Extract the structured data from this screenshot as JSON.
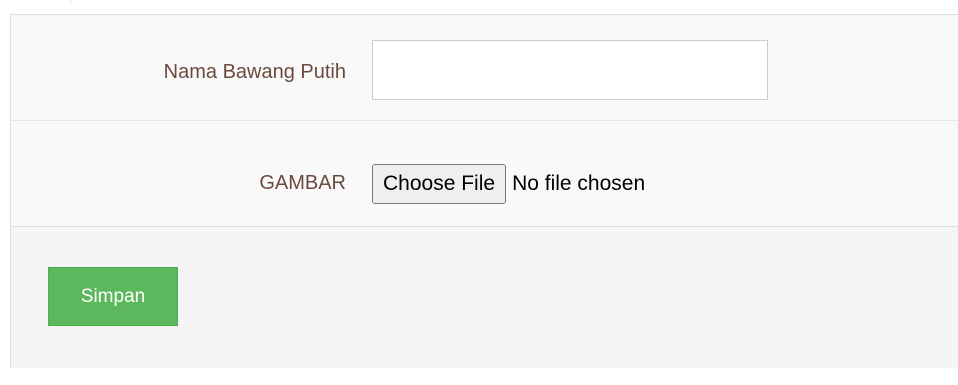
{
  "form": {
    "name_field": {
      "label": "Nama Bawang Putih",
      "value": "",
      "placeholder": ""
    },
    "image_field": {
      "label": "GAMBAR",
      "button_label": "Choose File",
      "status_text": "No file chosen"
    },
    "submit_label": "Simpan"
  },
  "colors": {
    "label_text": "#6b4a3e",
    "submit_background": "#5cb85c",
    "row_background": "#f9f9f9",
    "footer_background": "#f5f5f5",
    "border": "#dddddd"
  }
}
